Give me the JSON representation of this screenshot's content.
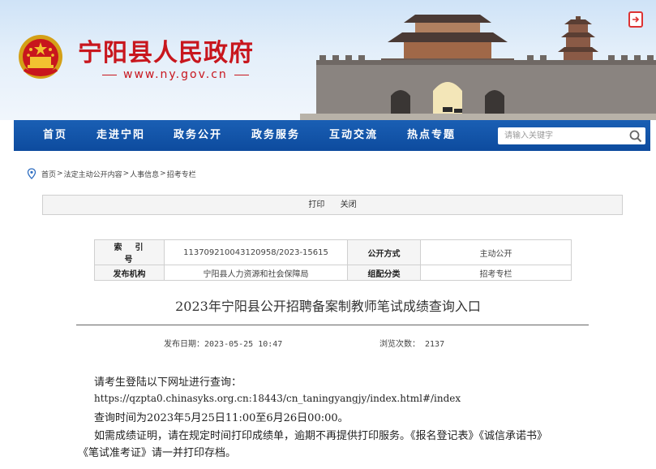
{
  "header": {
    "site_title": "宁阳县人民政府",
    "site_url": "www.ny.gov.cn"
  },
  "nav": {
    "items": [
      {
        "label": "首页"
      },
      {
        "label": "走进宁阳"
      },
      {
        "label": "政务公开"
      },
      {
        "label": "政务服务"
      },
      {
        "label": "互动交流"
      },
      {
        "label": "热点专题"
      }
    ],
    "search_placeholder": "请输入关键字"
  },
  "breadcrumb": {
    "items": [
      "首页",
      "法定主动公开内容",
      "人事信息",
      "招考专栏"
    ],
    "separator": ">"
  },
  "toolbar": {
    "print_label": "打印",
    "close_label": "关闭"
  },
  "meta": {
    "index_label": "索引号",
    "index_value": "113709210043120958/2023-15615",
    "open_mode_label": "公开方式",
    "open_mode_value": "主动公开",
    "publisher_label": "发布机构",
    "publisher_value": "宁阳县人力资源和社会保障局",
    "category_label": "组配分类",
    "category_value": "招考专栏"
  },
  "article": {
    "title": "2023年宁阳县公开招聘备案制教师笔试成绩查询入口",
    "publish_date": "发布日期：2023-05-25 10:47",
    "view_count": "浏览次数： 2137",
    "paragraphs": [
      "请考生登陆以下网址进行查询：",
      "https://qzpta0.chinasyks.org.cn:18443/cn_taningyangjy/index.html#/index",
      "查询时间为2023年5月25日11:00至6月26日00:00。",
      "如需成绩证明，请在规定时间打印成绩单，逾期不再提供打印服务。《报名登记表》《诚信承诺书》",
      "《笔试准考证》请一并打印存档。"
    ]
  },
  "colors": {
    "brand_red": "#c8161d",
    "nav_blue": "#0d4b9e"
  }
}
